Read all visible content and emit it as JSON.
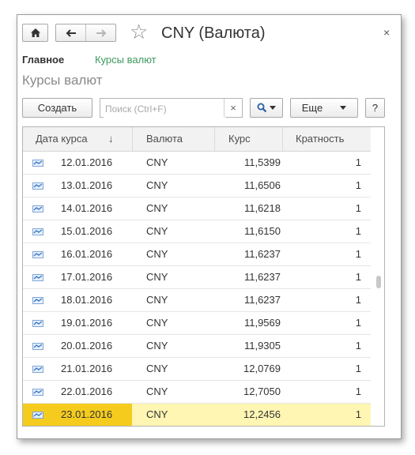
{
  "window": {
    "title": "CNY (Валюта)",
    "close_glyph": "×"
  },
  "toolbar": {
    "home_icon": "home-icon",
    "back_icon": "arrow-left-icon",
    "forward_icon": "arrow-right-icon",
    "favorite_icon": "star-icon"
  },
  "tabs": {
    "main": "Главное",
    "rates": "Курсы валют"
  },
  "section_title": "Курсы валют",
  "commands": {
    "create": "Создать",
    "search_placeholder": "Поиск (Ctrl+F)",
    "clear": "×",
    "more": "Еще",
    "help": "?"
  },
  "grid": {
    "headers": {
      "date": "Дата курса",
      "sort_arrow": "↓",
      "currency": "Валюта",
      "rate": "Курс",
      "multiplier": "Кратность"
    },
    "rows": [
      {
        "date": "12.01.2016",
        "currency": "CNY",
        "rate": "11,5399",
        "multiplier": "1"
      },
      {
        "date": "13.01.2016",
        "currency": "CNY",
        "rate": "11,6506",
        "multiplier": "1"
      },
      {
        "date": "14.01.2016",
        "currency": "CNY",
        "rate": "11,6218",
        "multiplier": "1"
      },
      {
        "date": "15.01.2016",
        "currency": "CNY",
        "rate": "11,6150",
        "multiplier": "1"
      },
      {
        "date": "16.01.2016",
        "currency": "CNY",
        "rate": "11,6237",
        "multiplier": "1"
      },
      {
        "date": "17.01.2016",
        "currency": "CNY",
        "rate": "11,6237",
        "multiplier": "1"
      },
      {
        "date": "18.01.2016",
        "currency": "CNY",
        "rate": "11,6237",
        "multiplier": "1"
      },
      {
        "date": "19.01.2016",
        "currency": "CNY",
        "rate": "11,9569",
        "multiplier": "1"
      },
      {
        "date": "20.01.2016",
        "currency": "CNY",
        "rate": "11,9305",
        "multiplier": "1"
      },
      {
        "date": "21.01.2016",
        "currency": "CNY",
        "rate": "12,0769",
        "multiplier": "1"
      },
      {
        "date": "22.01.2016",
        "currency": "CNY",
        "rate": "12,7050",
        "multiplier": "1"
      },
      {
        "date": "23.01.2016",
        "currency": "CNY",
        "rate": "12,2456",
        "multiplier": "1",
        "selected": true
      }
    ]
  },
  "colors": {
    "accent_green": "#3d9a5f",
    "selected_row": "#fff6b3",
    "selected_cell": "#f5cc1e",
    "row_icon": "#3a78c8"
  }
}
